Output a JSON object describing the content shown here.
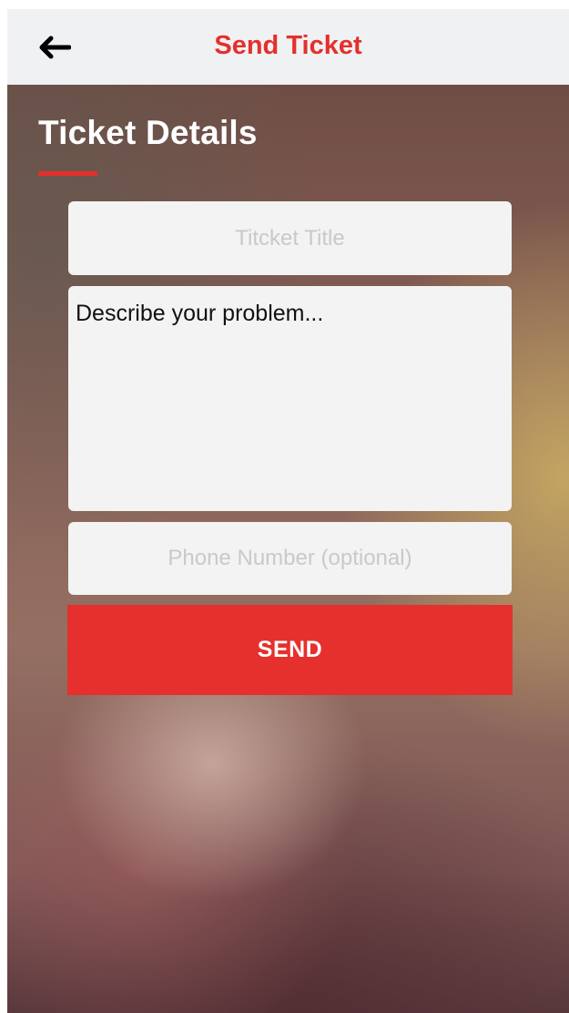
{
  "header": {
    "title": "Send Ticket",
    "back_icon": "arrow-left-icon"
  },
  "section": {
    "title": "Ticket Details"
  },
  "form": {
    "title_placeholder": "Titcket Title",
    "title_value": "",
    "description_placeholder": "Describe your problem...",
    "description_value": "",
    "phone_placeholder": "Phone Number (optional)",
    "phone_value": "",
    "send_label": "SEND"
  },
  "colors": {
    "accent": "#e3302d",
    "navbar_bg": "#f0f1f3",
    "field_bg": "#f3f3f3",
    "button_bg": "#e5302e"
  }
}
